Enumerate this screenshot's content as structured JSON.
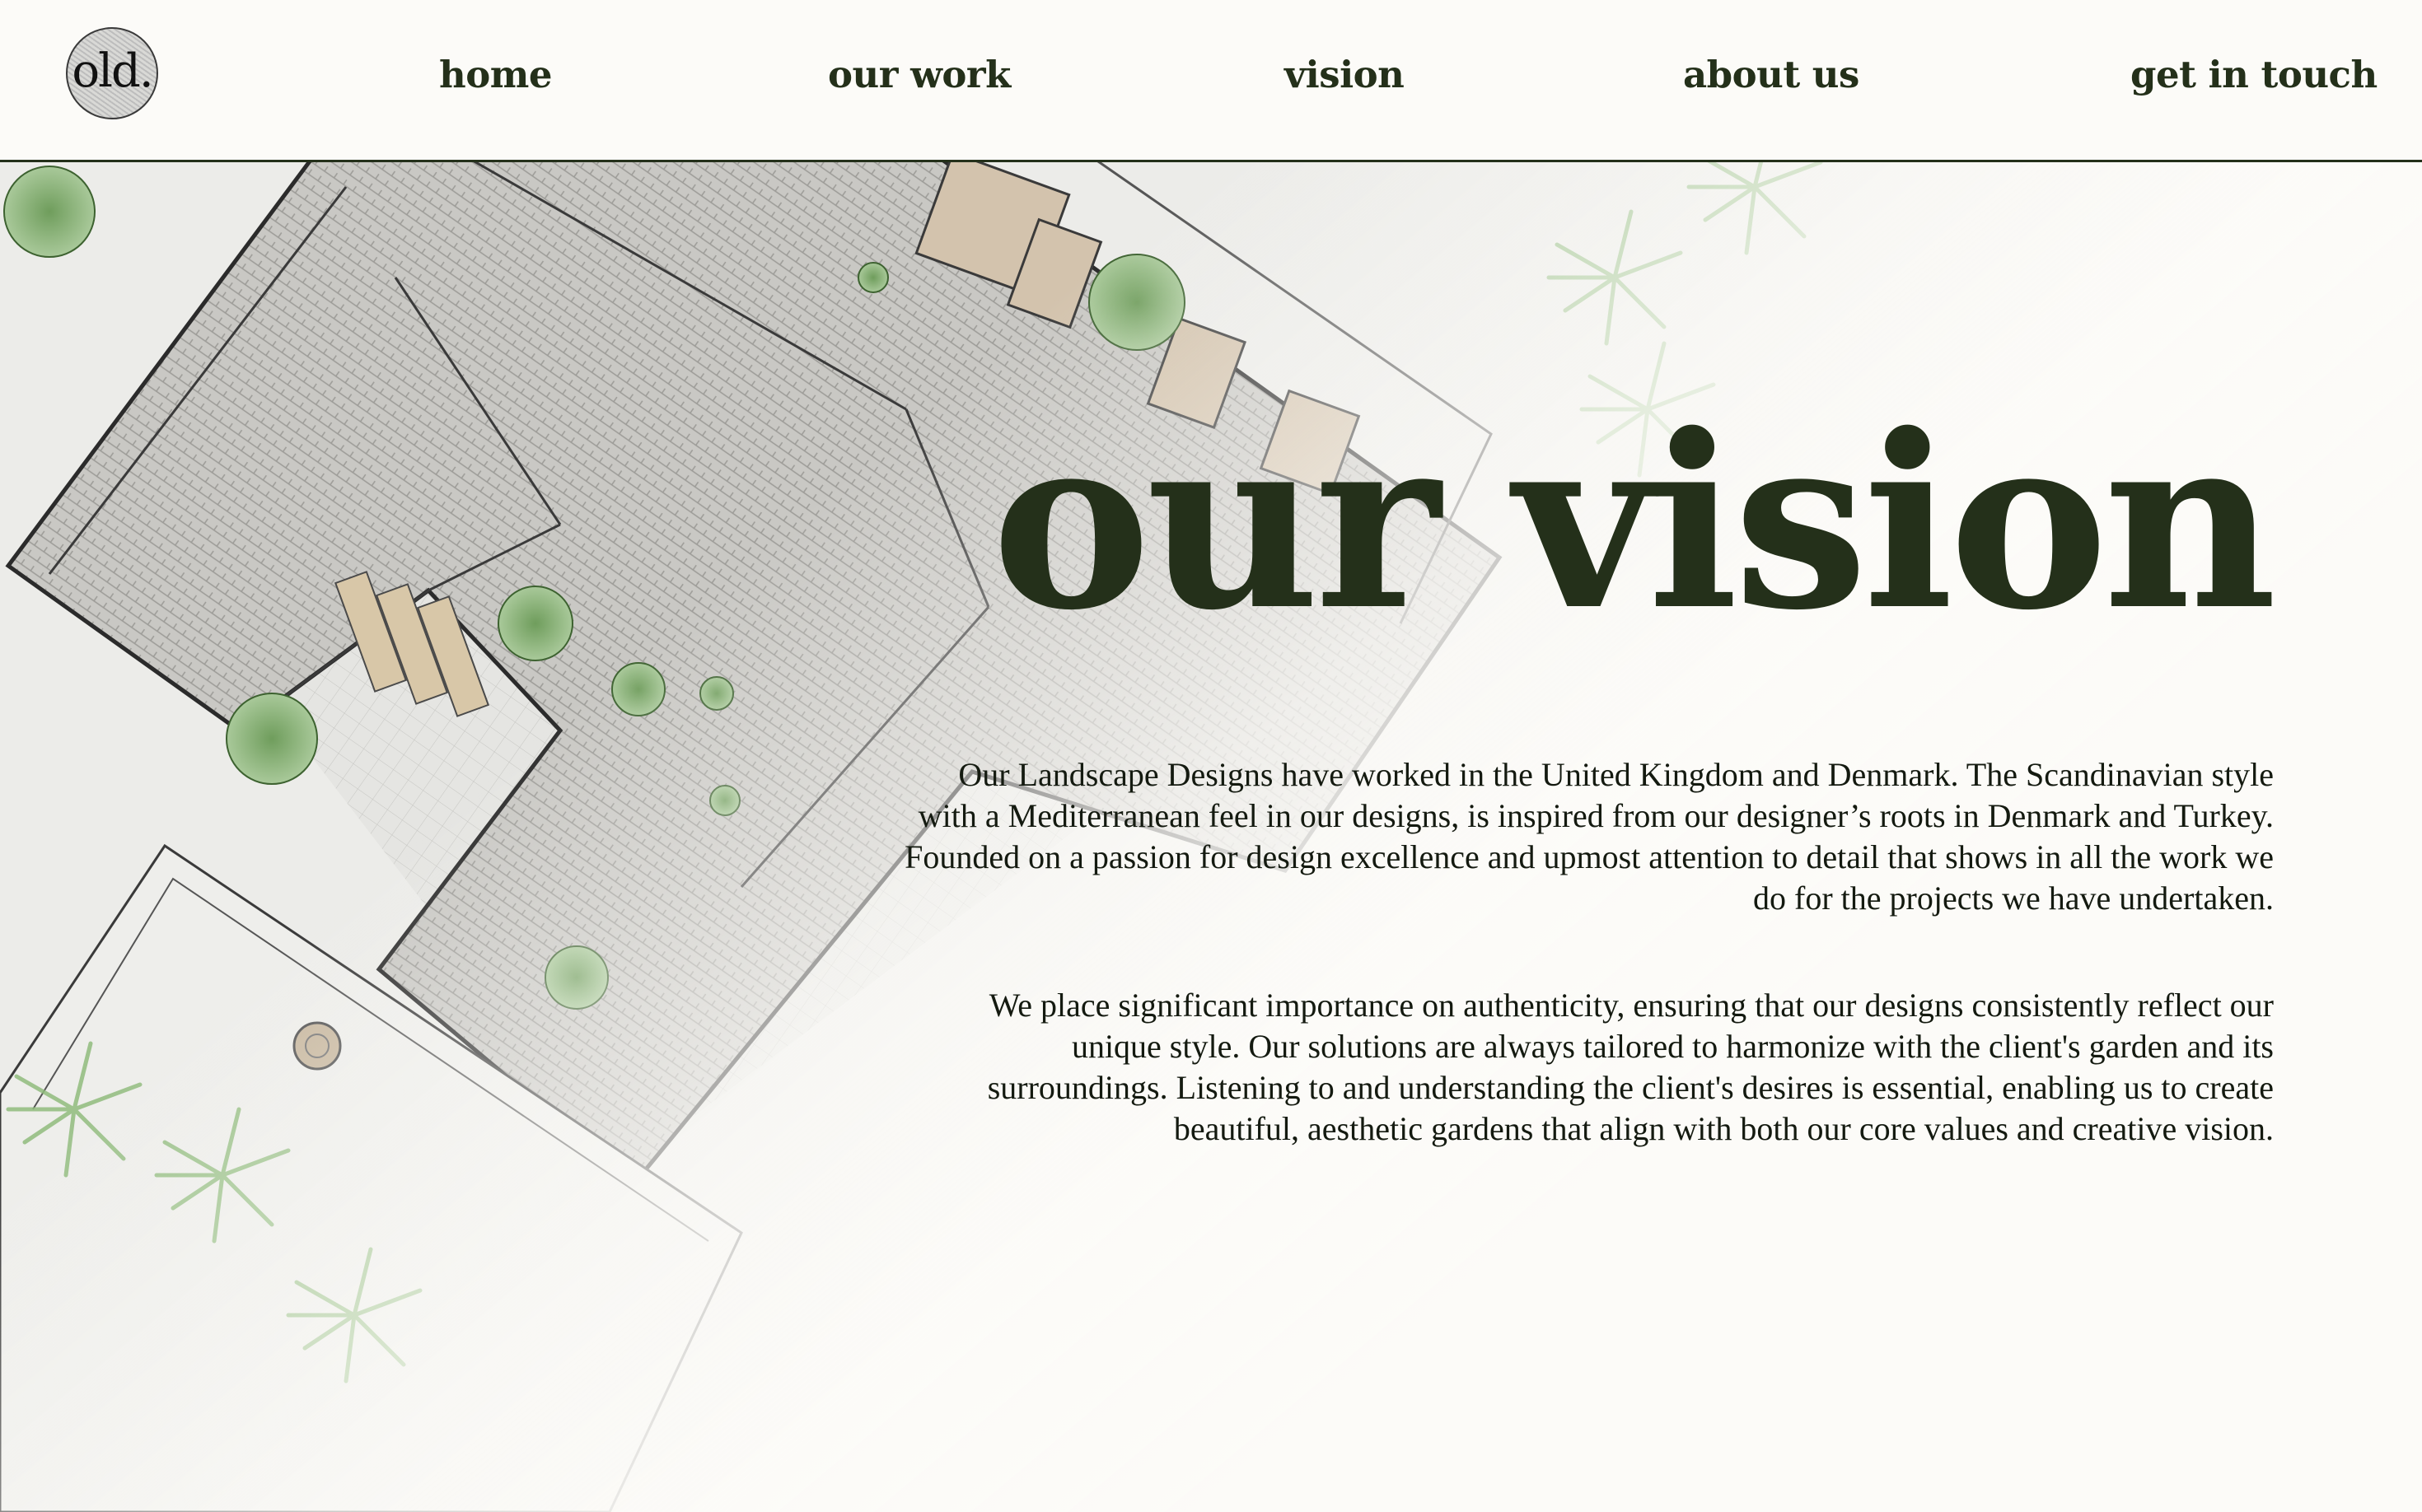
{
  "header": {
    "logo_text": "old.",
    "nav": {
      "home": "home",
      "our_work": "our work",
      "vision": "vision",
      "about_us": "about us",
      "get_in_touch": "get in touch"
    }
  },
  "hero": {
    "title": "our vision",
    "paragraphs": [
      "Our Landscape Designs have worked in the United Kingdom and Denmark. The Scandinavian style with a Mediterranean feel in our designs, is inspired from our designer’s roots in Denmark and Turkey. Founded on a passion for design excellence and upmost attention to detail that shows in all the work we do for the projects we have undertaken.",
      "We place significant importance on authenticity, ensuring that our designs consistently reflect our unique style. Our solutions are always tailored to harmonize with the client's garden and its surroundings. Listening to and understanding the client's desires is essential, enabling us to create beautiful, aesthetic gardens that align with both our core values and creative vision."
    ]
  },
  "background": {
    "image": "landscape-plan-illustration"
  },
  "colors": {
    "background": "#fcfbf8",
    "text_dark_green": "#24301a",
    "body_text": "#141a10",
    "roof_grey": "#bdbcb8",
    "plant_green": "#8fbb7c"
  }
}
